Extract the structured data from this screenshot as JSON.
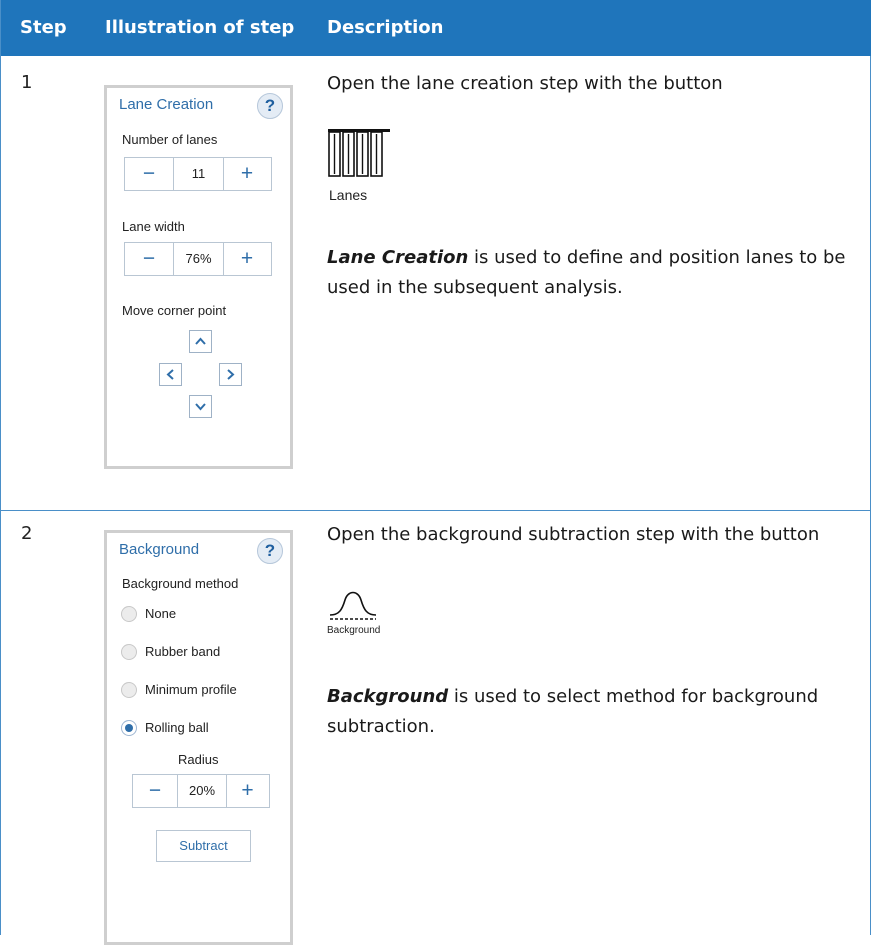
{
  "header": {
    "col_step": "Step",
    "col_illustration": "Illustration of step",
    "col_description": "Description"
  },
  "rows": [
    {
      "step": "1",
      "panel": {
        "title": "Lane Creation",
        "help": "?",
        "lanes_label": "Number of lanes",
        "lanes_minus": "−",
        "lanes_value": "11",
        "lanes_plus": "+",
        "width_label": "Lane width",
        "width_minus": "−",
        "width_value": "76%",
        "width_plus": "+",
        "move_label": "Move corner point"
      },
      "desc_intro": "Open the lane creation step with the button",
      "icon_caption": "Lanes",
      "desc_bold": "Lane Creation",
      "desc_rest": " is used to define and position lanes to be used in the subsequent analysis."
    },
    {
      "step": "2",
      "panel": {
        "title": "Background",
        "help": "?",
        "method_label": "Background method",
        "options": [
          "None",
          "Rubber band",
          "Minimum profile",
          "Rolling ball"
        ],
        "selected": "Rolling ball",
        "radius_label": "Radius",
        "radius_minus": "−",
        "radius_value": "20%",
        "radius_plus": "+",
        "subtract_label": "Subtract"
      },
      "desc_intro": "Open the background subtraction step with the button",
      "icon_caption": "Background",
      "desc_bold": "Background",
      "desc_rest": " is used to select method for background subtraction."
    }
  ],
  "colors": {
    "header_bg": "#1f75bb",
    "accent": "#2f6ea9",
    "border": "#4a8fc8"
  }
}
